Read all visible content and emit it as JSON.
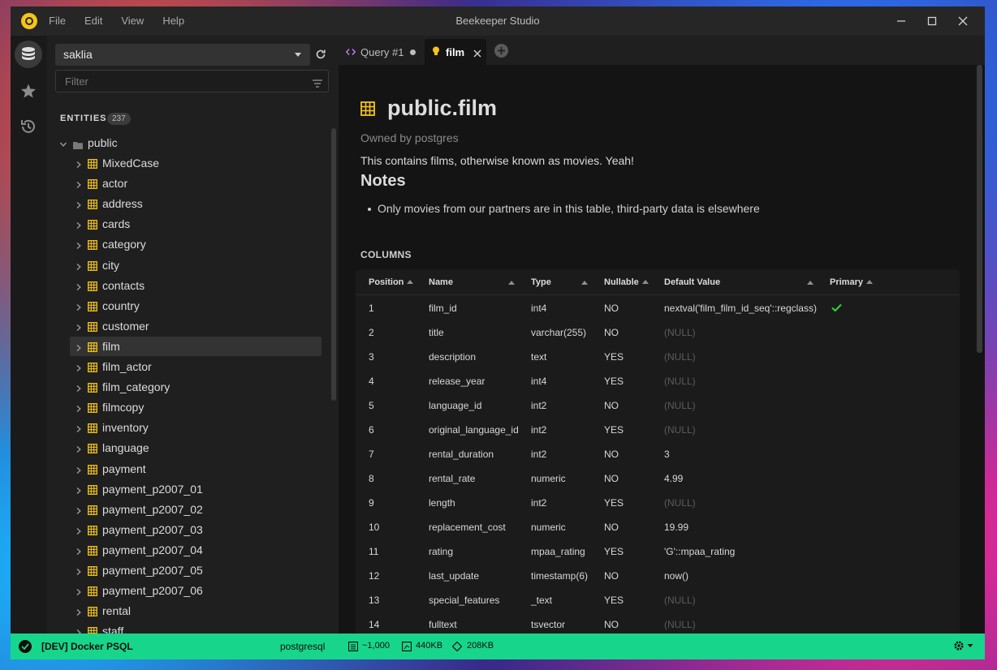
{
  "window": {
    "title": "Beekeeper Studio",
    "menu": [
      "File",
      "Edit",
      "View",
      "Help"
    ]
  },
  "sidebar": {
    "connection": "saklia",
    "filter_placeholder": "Filter",
    "entities_label": "ENTITIES",
    "entities_count": "237",
    "schema": "public",
    "tables": [
      "MixedCase",
      "actor",
      "address",
      "cards",
      "category",
      "city",
      "contacts",
      "country",
      "customer",
      "film",
      "film_actor",
      "film_category",
      "filmcopy",
      "inventory",
      "language",
      "payment",
      "payment_p2007_01",
      "payment_p2007_02",
      "payment_p2007_03",
      "payment_p2007_04",
      "payment_p2007_05",
      "payment_p2007_06",
      "rental",
      "staff"
    ],
    "selected": "film"
  },
  "tabs": [
    {
      "label": "Query #1",
      "icon": "code-icon",
      "status": "unsaved-dot"
    },
    {
      "label": "film",
      "icon": "bulb-icon",
      "active": true
    }
  ],
  "content": {
    "title": "public.film",
    "owner": "Owned by postgres",
    "description": "This contains films, otherwise known as movies. Yeah!",
    "notes_heading": "Notes",
    "notes": [
      "Only movies from our partners are in this table, third-party data is elsewhere"
    ],
    "columns_heading": "COLUMNS",
    "headers": [
      "Position",
      "Name",
      "Type",
      "Nullable",
      "Default Value",
      "Primary"
    ],
    "rows": [
      {
        "pos": "1",
        "name": "film_id",
        "type": "int4",
        "nullable": "NO",
        "default": "nextval('film_film_id_seq'::regclass)",
        "primary": true
      },
      {
        "pos": "2",
        "name": "title",
        "type": "varchar(255)",
        "nullable": "NO",
        "default": "(NULL)",
        "primary": false
      },
      {
        "pos": "3",
        "name": "description",
        "type": "text",
        "nullable": "YES",
        "default": "(NULL)",
        "primary": false
      },
      {
        "pos": "4",
        "name": "release_year",
        "type": "int4",
        "nullable": "YES",
        "default": "(NULL)",
        "primary": false
      },
      {
        "pos": "5",
        "name": "language_id",
        "type": "int2",
        "nullable": "NO",
        "default": "(NULL)",
        "primary": false
      },
      {
        "pos": "6",
        "name": "original_language_id",
        "type": "int2",
        "nullable": "YES",
        "default": "(NULL)",
        "primary": false
      },
      {
        "pos": "7",
        "name": "rental_duration",
        "type": "int2",
        "nullable": "NO",
        "default": "3",
        "primary": false
      },
      {
        "pos": "8",
        "name": "rental_rate",
        "type": "numeric",
        "nullable": "NO",
        "default": "4.99",
        "primary": false
      },
      {
        "pos": "9",
        "name": "length",
        "type": "int2",
        "nullable": "YES",
        "default": "(NULL)",
        "primary": false
      },
      {
        "pos": "10",
        "name": "replacement_cost",
        "type": "numeric",
        "nullable": "NO",
        "default": "19.99",
        "primary": false
      },
      {
        "pos": "11",
        "name": "rating",
        "type": "mpaa_rating",
        "nullable": "YES",
        "default": "'G'::mpaa_rating",
        "primary": false
      },
      {
        "pos": "12",
        "name": "last_update",
        "type": "timestamp(6)",
        "nullable": "NO",
        "default": "now()",
        "primary": false
      },
      {
        "pos": "13",
        "name": "special_features",
        "type": "_text",
        "nullable": "YES",
        "default": "(NULL)",
        "primary": false
      },
      {
        "pos": "14",
        "name": "fulltext",
        "type": "tsvector",
        "nullable": "NO",
        "default": "(NULL)",
        "primary": false
      }
    ]
  },
  "statusbar": {
    "connection": "[DEV] Docker PSQL",
    "db_type": "postgresql",
    "rows": "~1,000",
    "table_size": "440KB",
    "index_size": "208KB"
  },
  "colors": {
    "accent": "#17d68b",
    "table_icon": "#f5c518",
    "logo": "#f5c518",
    "check": "#2ecc40"
  }
}
